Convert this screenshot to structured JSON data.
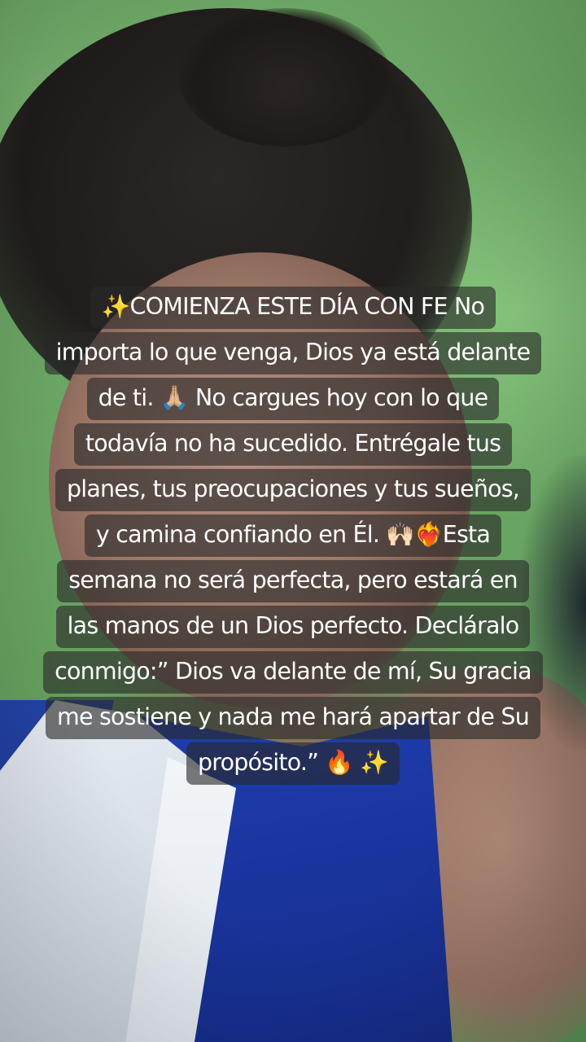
{
  "caption": {
    "lines": [
      "✨COMIENZA ESTE DÍA CON FE No",
      "importa lo que venga, Dios ya está delante",
      "de ti. 🙏🏼 No cargues hoy con lo que",
      "todavía no ha sucedido. Entrégale tus",
      "planes, tus preocupaciones y tus sueños,",
      "y camina confiando en Él. 🙌🏻❤️‍🔥Esta",
      "semana no será perfecta, pero estará en",
      "las manos de un Dios perfecto. Decláralo",
      "conmigo:” Dios va delante de mí, Su gracia",
      "me sostiene y nada me hará apartar de Su",
      "propósito.” 🔥 ✨"
    ]
  },
  "colors": {
    "caption_background": "#282828",
    "caption_text": "#ffffff",
    "background_green": "#6aa663",
    "shirt_blue": "#1a35a0"
  }
}
